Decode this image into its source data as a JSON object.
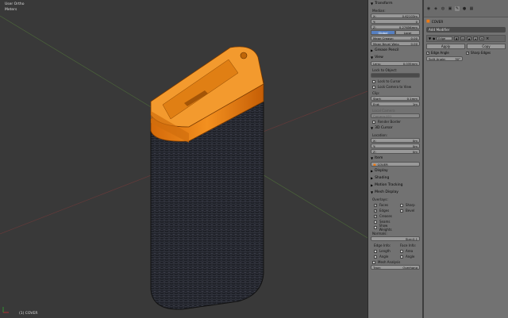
{
  "viewport": {
    "view_label": "User Ortho",
    "unit_label": "Meters",
    "object_label": "(1) COVER"
  },
  "npanel": {
    "transform": {
      "title": "Transform",
      "median_label": "Median:",
      "x": "X:",
      "x_val": "0.62103m",
      "y": "Y:",
      "y_val": "0",
      "z": "Z:",
      "z_val": "0.27656mm",
      "global": "Global",
      "local": "Local",
      "mean_crease": "Mean Crease:",
      "mean_crease_val": "0.00",
      "mean_bevel": "Mean Bevel Weig",
      "mean_bevel_val": "0.00"
    },
    "grease": {
      "title": "Grease Pencil"
    },
    "view": {
      "title": "View",
      "lens": "Lens:",
      "lens_val": "0.035mm",
      "lock_object": "Lock to Object:",
      "lock_cursor": "Lock to Cursor",
      "lock_camera": "Lock Camera to View",
      "clip": "Clip:",
      "start": "Start:",
      "start_val": "0.1mm",
      "end": "End:",
      "end_val": "1m",
      "local_camera": "Local Camera",
      "camera_val": "Camera.001",
      "render_border": "Render Border"
    },
    "cursor": {
      "title": "3D Cursor",
      "location": "Location:",
      "x": "X:",
      "x_val": "0m",
      "y": "Y:",
      "y_val": "0m",
      "z": "Z:",
      "z_val": "0m"
    },
    "item": {
      "title": "Item",
      "name": "COVER"
    },
    "collapsed": [
      "Display",
      "Shading",
      "Motion Tracking",
      "Mesh Display"
    ],
    "overlays": {
      "label": "Overlays:",
      "items": [
        [
          "Faces",
          "Sharp"
        ],
        [
          "Edges",
          "Bevel"
        ],
        [
          "Creases",
          ""
        ],
        [
          "Seams",
          ""
        ],
        [
          "Show Weights",
          ""
        ]
      ]
    },
    "normals": {
      "label": "Normals:",
      "size": "Size:0.1"
    },
    "edgeinfo": {
      "edge": "Edge Info:",
      "face": "Face Info:",
      "length": "Length",
      "area": "Area",
      "angle": "Angle",
      "angle2": "Angle"
    },
    "mesh_analysis": {
      "title": "Mesh Analysis",
      "type": "Type:",
      "type_val": "Overhang"
    }
  },
  "props": {
    "object": "COVER",
    "add_modifier": "Add Modifier",
    "modifier_name": "Edge",
    "apply": "Apply",
    "copy": "Copy",
    "edge_angle": "Edge Angle",
    "sharp_edges": "Sharp Edges",
    "split_angle": "Split Angle:",
    "split_angle_val": "30°"
  },
  "colors": {
    "viewport_bg": "#393939",
    "selection": "#f07a12",
    "panel": "#727272"
  }
}
